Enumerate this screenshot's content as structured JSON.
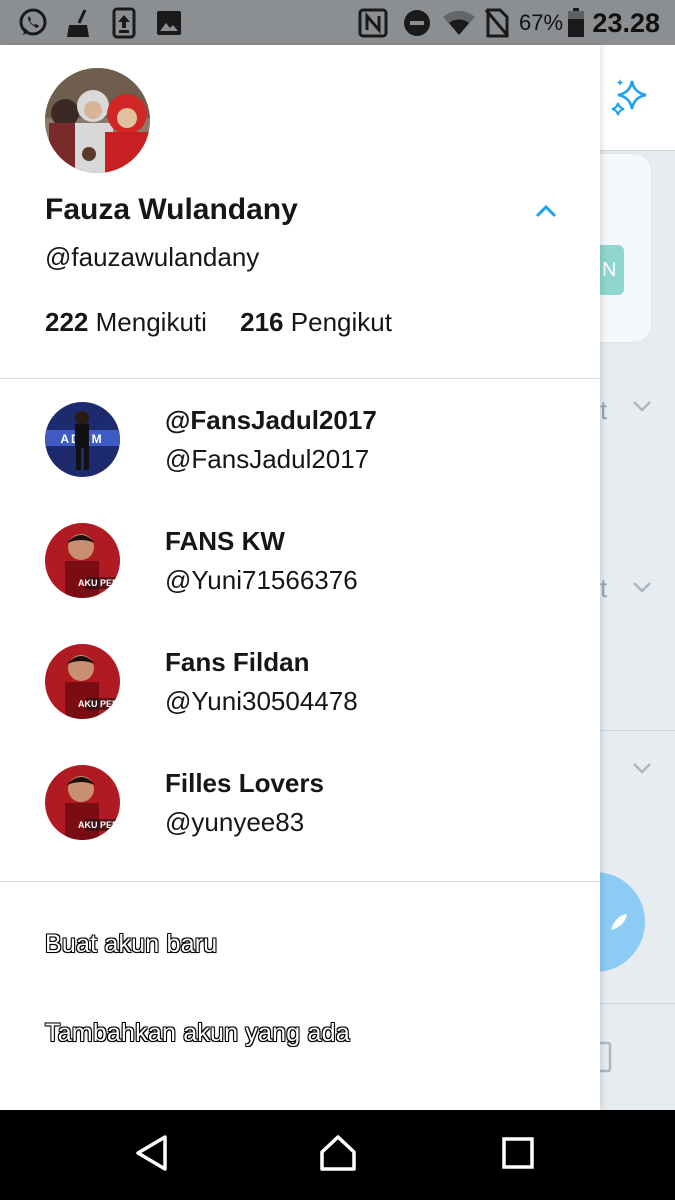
{
  "status_bar": {
    "icons_left": [
      "whatsapp-icon",
      "cleaner-icon",
      "upload-icon",
      "image-icon"
    ],
    "icons_right": [
      "nfc-icon",
      "do-not-disturb-icon",
      "wifi-icon",
      "no-sim-icon",
      "battery-icon"
    ],
    "battery": "67%",
    "time": "23.28"
  },
  "profile": {
    "name": "Fauza Wulandany",
    "handle": "@fauzawulandany",
    "following_count": "222",
    "following_label": "Mengikuti",
    "followers_count": "216",
    "followers_label": "Pengikut"
  },
  "accounts": [
    {
      "name": "@FansJadul2017",
      "handle": "@FansJadul2017"
    },
    {
      "name": "FANS KW",
      "handle": "@Yuni71566376"
    },
    {
      "name": "Fans Fildan",
      "handle": "@Yuni30504478"
    },
    {
      "name": "Filles Lovers",
      "handle": "@yunyee83"
    }
  ],
  "avatar_text": "AKU PERGI",
  "avatar_text_2": "ADEM",
  "menu": {
    "create_account": "Buat akun baru",
    "add_existing": "Tambahkan akun yang ada"
  },
  "background": {
    "pill_letter": "N",
    "letters": [
      "t",
      "t"
    ]
  },
  "colors": {
    "accent": "#1da1f2",
    "text": "#14171a",
    "divider": "#d5dbe0"
  }
}
